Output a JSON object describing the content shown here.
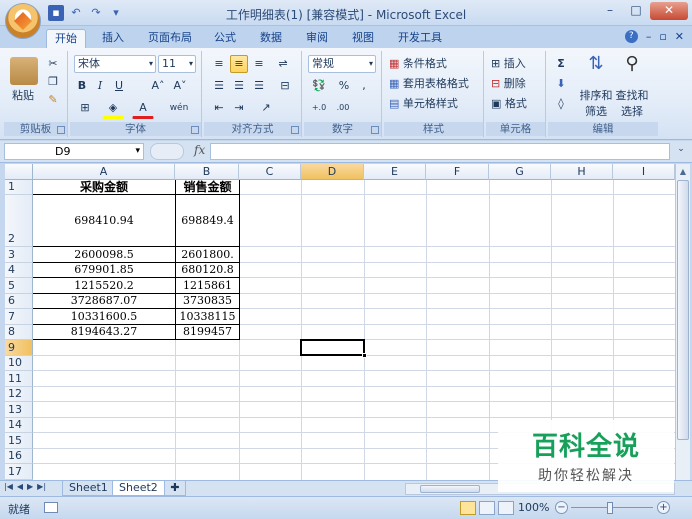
{
  "window": {
    "title": "工作明细表(1)  [兼容模式] - Microsoft Excel",
    "controls": {
      "minimize": "–",
      "maximize": "□",
      "close": "✕"
    }
  },
  "ribbon_tabs": [
    "开始",
    "插入",
    "页面布局",
    "公式",
    "数据",
    "审阅",
    "视图",
    "开发工具"
  ],
  "ribbon_right": {
    "help": "?",
    "min": "–",
    "restore": "▫",
    "close": "✕"
  },
  "ribbon": {
    "clipboard": {
      "label": "剪贴板",
      "paste": "粘贴"
    },
    "font": {
      "label": "字体",
      "font_name": "宋体",
      "font_size": "11",
      "bold": "B",
      "italic": "I",
      "underline": "U",
      "grow": "A˄",
      "shrink": "A˅",
      "wen": "wén"
    },
    "alignment": {
      "label": "对齐方式"
    },
    "number": {
      "label": "数字",
      "format": "常规",
      "percent": "%",
      "comma": ",",
      "inc": "+.0 .00",
      "dec": ".00 →.0"
    },
    "styles": {
      "label": "样式",
      "conditional": "条件格式",
      "table": "套用表格格式",
      "cell_styles": "单元格样式"
    },
    "cells": {
      "label": "单元格",
      "insert": "插入",
      "delete": "删除",
      "format": "格式"
    },
    "editing": {
      "label": "编辑",
      "sigma": "Σ",
      "sort": "排序和",
      "sort2": "筛选",
      "find": "查找和",
      "find2": "选择"
    }
  },
  "formula_bar": {
    "name_box": "D9",
    "fx": "fx",
    "value": ""
  },
  "columns": [
    "A",
    "B",
    "C",
    "D",
    "E",
    "F",
    "G",
    "H",
    "I"
  ],
  "rows": [
    "1",
    "2",
    "3",
    "4",
    "5",
    "6",
    "7",
    "8",
    "9",
    "10",
    "11",
    "12",
    "13",
    "14",
    "15",
    "16",
    "17"
  ],
  "table": {
    "headers": [
      "采购金额",
      "销售金额"
    ],
    "rows": [
      [
        "698410.94",
        "698849.4"
      ],
      [
        "2600098.5",
        "2601800."
      ],
      [
        "679901.85",
        "680120.8"
      ],
      [
        "1215520.2",
        "1215861"
      ],
      [
        "3728687.07",
        "3730835"
      ],
      [
        "10331600.5",
        "10338115"
      ],
      [
        "8194643.27",
        "8199457"
      ]
    ]
  },
  "sheets": [
    "Sheet1",
    "Sheet2"
  ],
  "active_sheet": "Sheet2",
  "status": {
    "text": "就绪",
    "zoom": "100%"
  },
  "watermark": {
    "title": "百科全说",
    "subtitle": "助你轻松解决"
  },
  "colors": {
    "accent": "#15428b",
    "ribbon_bg": "#e3ecf8",
    "selection": "#f1c15f",
    "watermark": "#17a05a"
  }
}
